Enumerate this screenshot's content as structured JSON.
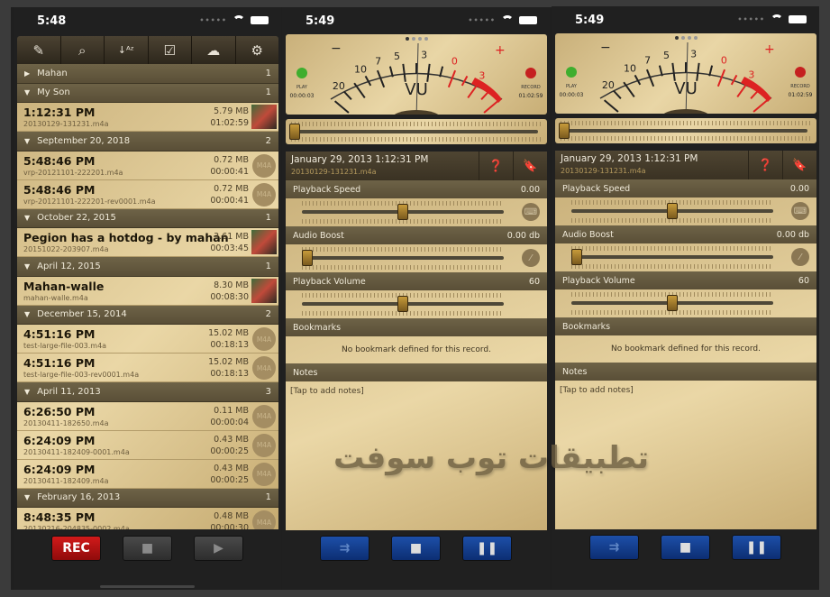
{
  "list_screen": {
    "status_time": "5:48",
    "toolbar": [
      "compose-icon",
      "search-icon",
      "sort-az-icon",
      "checkbox-icon",
      "cloud-icon",
      "gear-icon"
    ],
    "groups": [
      {
        "title": "Mahan",
        "count": "1",
        "expanded": false,
        "items": []
      },
      {
        "title": "My Son",
        "count": "1",
        "expanded": true,
        "items": [
          {
            "time": "1:12:31 PM",
            "file": "20130129-131231.m4a",
            "size": "5.79 MB",
            "duration": "01:02:59",
            "thumb": "photo"
          }
        ]
      },
      {
        "title": "September 20, 2018",
        "count": "2",
        "expanded": true,
        "items": [
          {
            "time": "5:48:46 PM",
            "file": "vrp-20121101-222201.m4a",
            "size": "0.72 MB",
            "duration": "00:00:41",
            "thumb": "M4A"
          },
          {
            "time": "5:48:46 PM",
            "file": "vrp-20121101-222201-rev0001.m4a",
            "size": "0.72 MB",
            "duration": "00:00:41",
            "thumb": "M4A"
          }
        ]
      },
      {
        "title": "October 22, 2015",
        "count": "1",
        "expanded": true,
        "items": [
          {
            "time": "Pegion has a hotdog - by mahan",
            "file": "20151022-203907.m4a",
            "size": "3.61 MB",
            "duration": "00:03:45",
            "thumb": "photo"
          }
        ]
      },
      {
        "title": "April 12, 2015",
        "count": "1",
        "expanded": true,
        "items": [
          {
            "time": "Mahan-walle",
            "file": "mahan-walle.m4a",
            "size": "8.30 MB",
            "duration": "00:08:30",
            "thumb": "photo"
          }
        ]
      },
      {
        "title": "December 15, 2014",
        "count": "2",
        "expanded": true,
        "items": [
          {
            "time": "4:51:16 PM",
            "file": "test-large-file-003.m4a",
            "size": "15.02 MB",
            "duration": "00:18:13",
            "thumb": "M4A"
          },
          {
            "time": "4:51:16 PM",
            "file": "test-large-file-003-rev0001.m4a",
            "size": "15.02 MB",
            "duration": "00:18:13",
            "thumb": "M4A"
          }
        ]
      },
      {
        "title": "April 11, 2013",
        "count": "3",
        "expanded": true,
        "items": [
          {
            "time": "6:26:50 PM",
            "file": "20130411-182650.m4a",
            "size": "0.11 MB",
            "duration": "00:00:04",
            "thumb": "M4A"
          },
          {
            "time": "6:24:09 PM",
            "file": "20130411-182409-0001.m4a",
            "size": "0.43 MB",
            "duration": "00:00:25",
            "thumb": "M4A"
          },
          {
            "time": "6:24:09 PM",
            "file": "20130411-182409.m4a",
            "size": "0.43 MB",
            "duration": "00:00:25",
            "thumb": "M4A"
          }
        ]
      },
      {
        "title": "February 16, 2013",
        "count": "1",
        "expanded": true,
        "items": [
          {
            "time": "8:48:35 PM",
            "file": "20130216-204835-0002.m4a",
            "size": "0.48 MB",
            "duration": "00:00:30",
            "thumb": "M4A"
          }
        ]
      }
    ],
    "rec_label": "REC"
  },
  "detail_screens": [
    {
      "status_time": "5:49"
    },
    {
      "status_time": "5:49"
    }
  ],
  "detail": {
    "vu": {
      "scale_labels": [
        "20",
        "10",
        "7",
        "5",
        "3",
        "0",
        "3"
      ],
      "minus": "−",
      "plus": "+",
      "label": "VU",
      "play_label": "PLAY",
      "play_time": "00:00:03",
      "record_label": "RECORD",
      "record_time": "01:02:59"
    },
    "record_datetime": "January 29, 2013 1:12:31 PM",
    "record_file": "20130129-131231.m4a",
    "playback_speed": {
      "label": "Playback Speed",
      "value": "0.00",
      "level": 0.5
    },
    "audio_boost": {
      "label": "Audio Boost",
      "value": "0.00 db",
      "level": 0
    },
    "playback_volume": {
      "label": "Playback Volume",
      "value": "60",
      "level": 0.5
    },
    "bookmarks": {
      "label": "Bookmarks",
      "empty": "No bookmark defined for this record."
    },
    "notes": {
      "label": "Notes",
      "placeholder": "[Tap to add notes]"
    },
    "seek_level": 0
  },
  "watermark": "تطبيقات توب سوفت",
  "colors": {
    "rec": "#c41414",
    "transport_blue": "#143e8e",
    "section_header": "#5f543b",
    "parchment": "#e0c992"
  }
}
